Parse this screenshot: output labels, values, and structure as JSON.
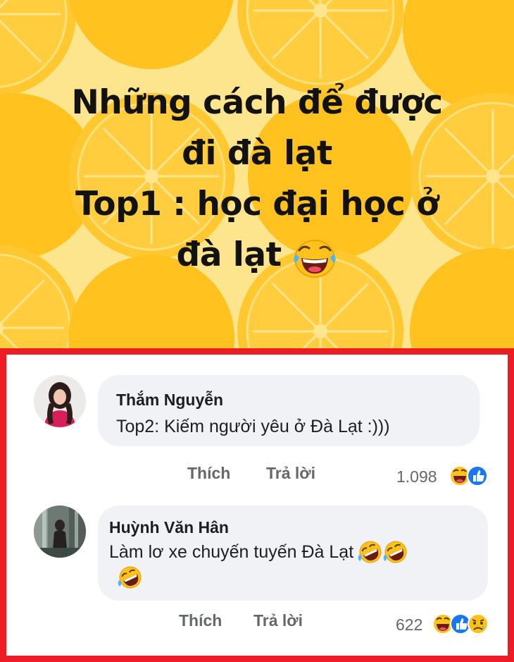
{
  "post": {
    "caption_lines": [
      "Những cách để được",
      "đi đà lạt",
      "Top1 : học đại học ở",
      "đà lạt"
    ],
    "caption_emoji": "laughing-face-icon",
    "background_colors": {
      "base": "#fde58e",
      "orange": "#ffc21f",
      "orange_light": "#ffd14a"
    }
  },
  "comments": [
    {
      "author": "Thắm Nguyễn",
      "text": "Top2: Kiếm người yêu ở Đà Lạt :)))",
      "like_label": "Thích",
      "reply_label": "Trả lời",
      "reaction_count": "1.098",
      "reactions": [
        "haha",
        "like"
      ]
    },
    {
      "author": "Huỳnh Văn Hân",
      "text_line1": "Làm lơ xe chuyến tuyến Đà Lạt",
      "like_label": "Thích",
      "reply_label": "Trả lời",
      "reaction_count": "622",
      "reactions": [
        "haha",
        "like",
        "sad"
      ]
    }
  ],
  "colors": {
    "frame_red": "#ee1c24",
    "bubble_bg": "#f0f2f5",
    "meta_grey": "#65676b",
    "like_blue": "#1877f2"
  }
}
